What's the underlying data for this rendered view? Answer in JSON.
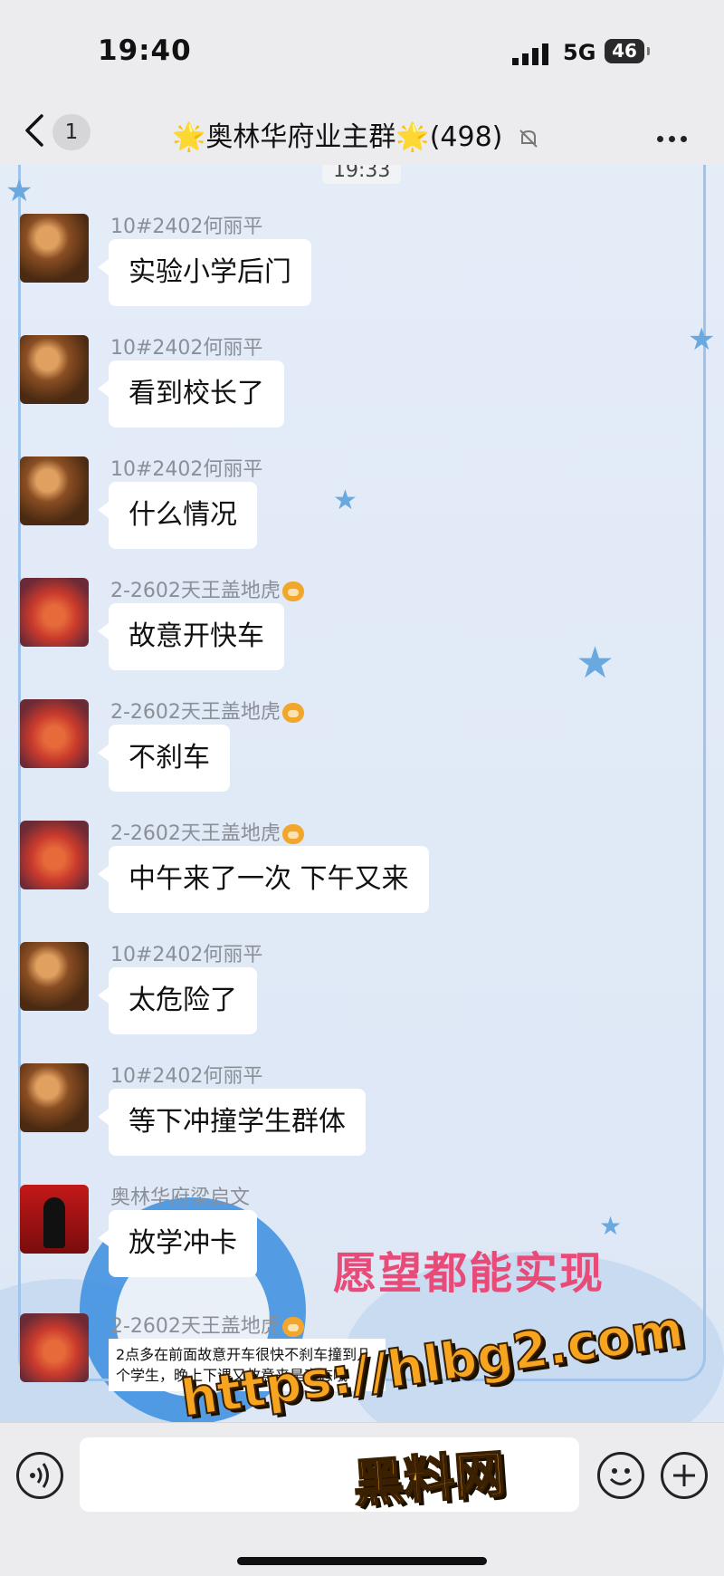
{
  "status_bar": {
    "time": "19:40",
    "network": "5G",
    "battery": "46"
  },
  "header": {
    "back_icon": "chevron-left-icon",
    "unread_count": "1",
    "title": "🌟奥林华府业主群🌟(498)",
    "mute_icon": "bell-muted-icon",
    "more_icon": "more-dots-icon"
  },
  "chat": {
    "timestamp": "19:33",
    "messages": [
      {
        "sender": "10#2402何丽平",
        "text": "实验小学后门",
        "avatar": "woman-avatar"
      },
      {
        "sender": "10#2402何丽平",
        "text": "看到校长了",
        "avatar": "woman-avatar"
      },
      {
        "sender": "10#2402何丽平",
        "text": "什么情况",
        "avatar": "woman-avatar"
      },
      {
        "sender": "2-2602天王盖地虎",
        "text": "故意开快车",
        "avatar": "rabbit-avatar"
      },
      {
        "sender": "2-2602天王盖地虎",
        "text": "不刹车",
        "avatar": "rabbit-avatar"
      },
      {
        "sender": "2-2602天王盖地虎",
        "text": "中午来了一次 下午又来",
        "avatar": "rabbit-avatar"
      },
      {
        "sender": "10#2402何丽平",
        "text": "太危险了",
        "avatar": "woman-avatar"
      },
      {
        "sender": "10#2402何丽平",
        "text": "等下冲撞学生群体",
        "avatar": "woman-avatar"
      },
      {
        "sender": "奥林华府梁启文",
        "text": "放学冲卡",
        "avatar": "silhouette-avatar"
      },
      {
        "sender": "2-2602天王盖地虎",
        "text": "2点多在前面故意开车很快不刹车撞到几个学生，晚上下课又故意来是变态哦",
        "avatar": "rabbit-avatar"
      }
    ],
    "background_text": "愿望都能实现",
    "watermark_url": "https://hlbg2.com",
    "watermark_name": "黑料网"
  },
  "input_bar": {
    "voice_icon": "voice-icon",
    "emoji_icon": "emoji-icon",
    "plus_icon": "plus-icon"
  }
}
